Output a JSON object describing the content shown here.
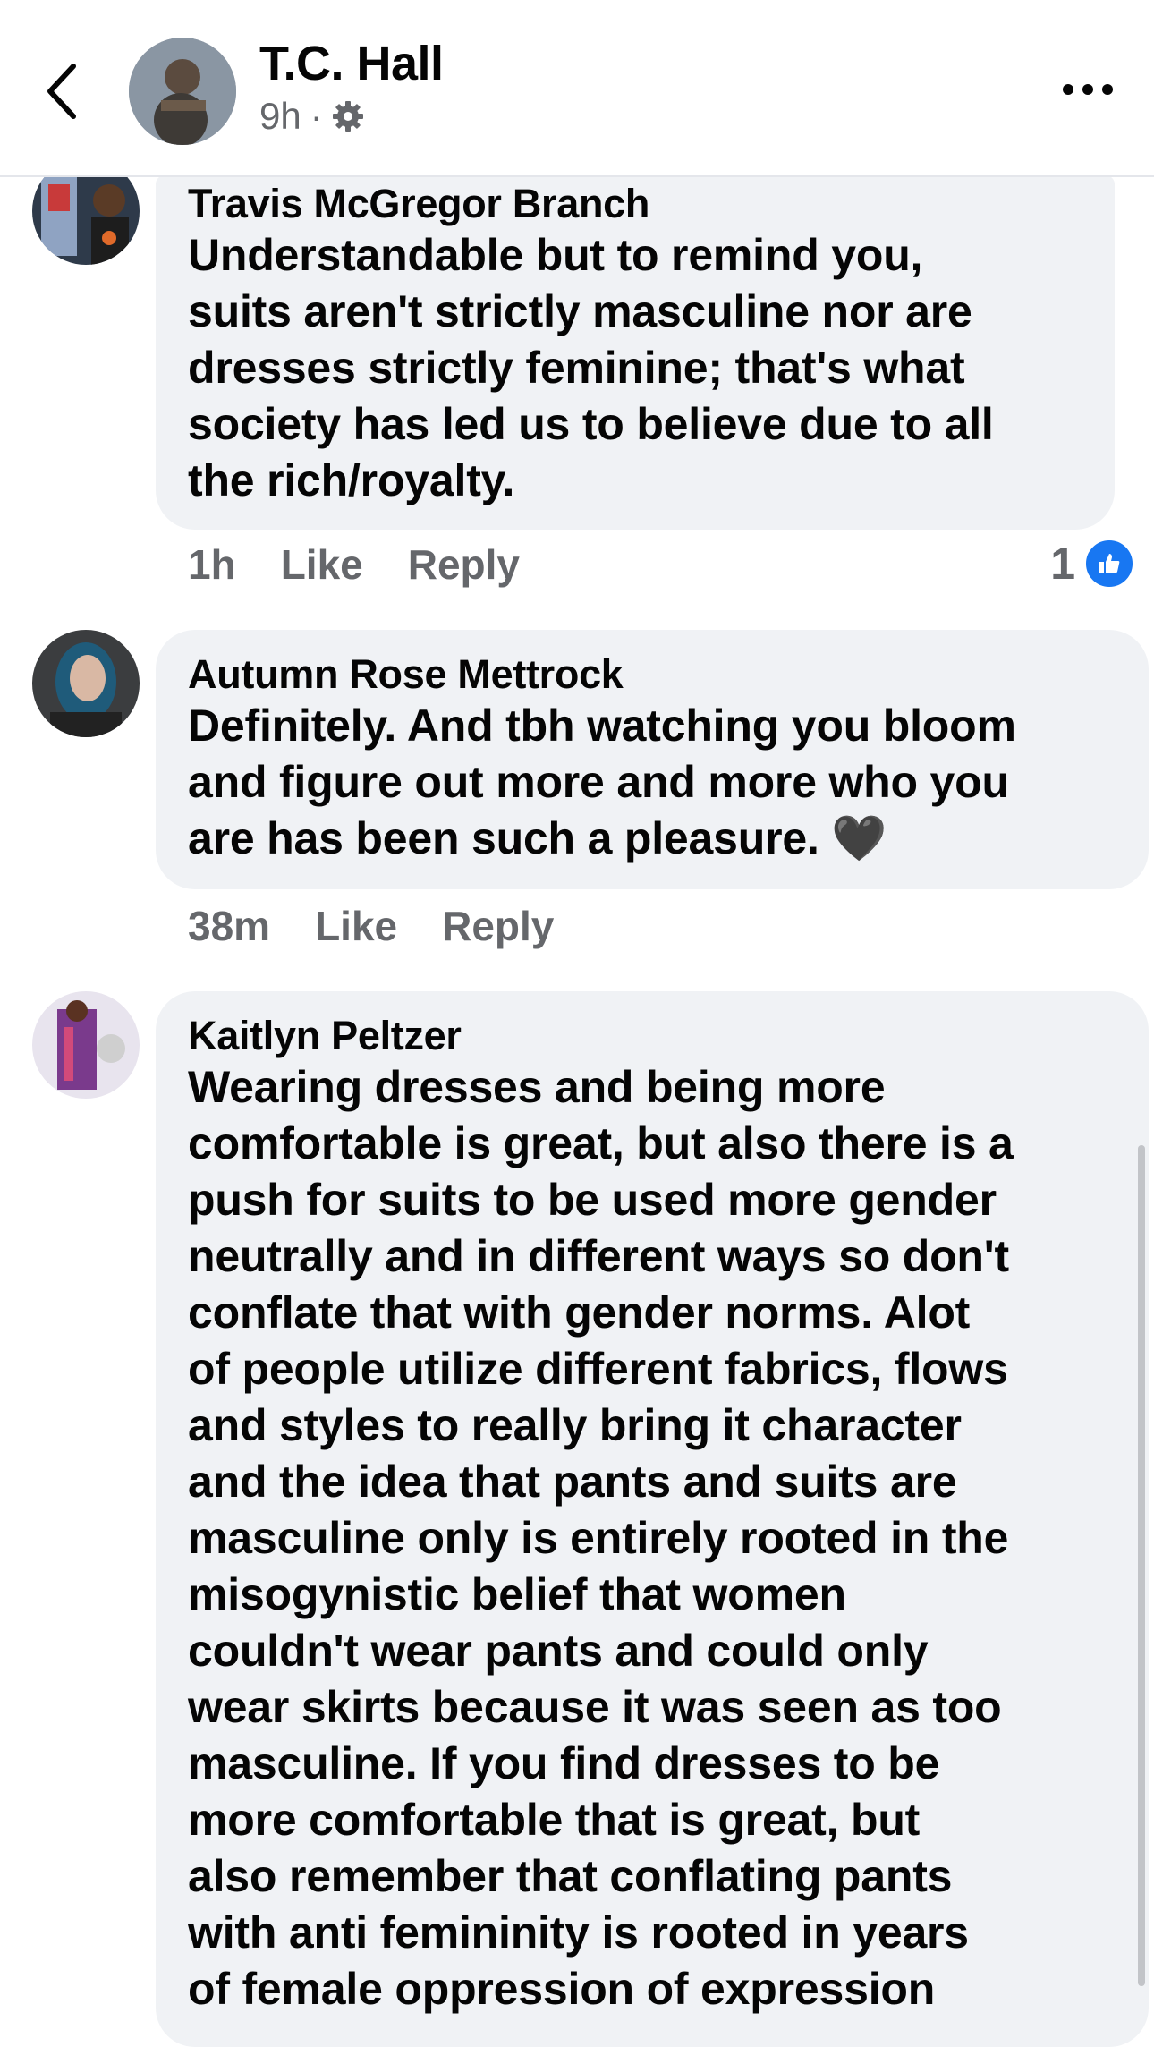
{
  "header": {
    "name": "T.C. Hall",
    "time": "9h",
    "dot": "·",
    "back_icon": "chevron-left-icon",
    "privacy_icon": "gear-icon",
    "more_icon": "more-horizontal-icon"
  },
  "comments": [
    {
      "author": "Travis McGregor Branch",
      "lines": [
        "Understandable but to remind you,",
        "suits aren't strictly masculine nor are",
        "dresses strictly feminine; that's what",
        "society has led us to believe due to all",
        "the rich/royalty."
      ],
      "time": "1h",
      "like": "Like",
      "reply": "Reply",
      "reaction_count": "1"
    },
    {
      "author": "Autumn Rose Mettrock",
      "lines": [
        "Definitely. And tbh watching you bloom",
        "and figure out more and more who you",
        "are has been such a pleasure. 🖤"
      ],
      "time": "38m",
      "like": "Like",
      "reply": "Reply"
    },
    {
      "author": "Kaitlyn Peltzer",
      "lines": [
        "Wearing dresses and being more",
        "comfortable is great, but also there is a",
        "push for suits to be used more gender",
        "neutrally and in different ways so don't",
        "conflate that with gender norms. Alot",
        "of people utilize different fabrics, flows",
        "and styles to really bring it character",
        "and the idea that pants and suits are",
        "masculine only is entirely rooted in the",
        "misogynistic belief that women",
        "couldn't wear pants and could only",
        "wear skirts because it was seen as too",
        "masculine. If you find dresses to be",
        "more comfortable that is great, but",
        "also remember that conflating pants",
        "with anti femininity is rooted in years",
        "of female oppression of expression"
      ]
    }
  ],
  "colors": {
    "bubble": "#f0f2f5",
    "secondary_text": "#65676b",
    "like_blue": "#1877f2"
  }
}
